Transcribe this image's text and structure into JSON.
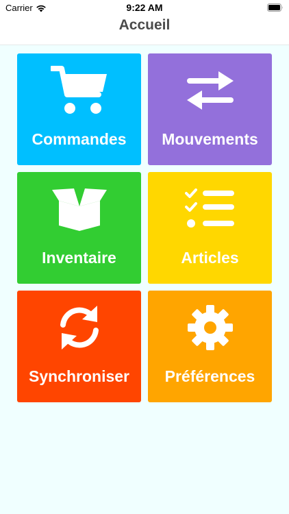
{
  "status_bar": {
    "carrier": "Carrier",
    "time": "9:22 AM"
  },
  "nav": {
    "title": "Accueil"
  },
  "tiles": [
    {
      "label": "Commandes",
      "icon": "shopping-cart-icon",
      "color": "#00BFFF"
    },
    {
      "label": "Mouvements",
      "icon": "exchange-arrows-icon",
      "color": "#9370DB"
    },
    {
      "label": "Inventaire",
      "icon": "open-box-icon",
      "color": "#32CD32"
    },
    {
      "label": "Articles",
      "icon": "checklist-icon",
      "color": "#FFD700"
    },
    {
      "label": "Synchroniser",
      "icon": "sync-icon",
      "color": "#FF4500"
    },
    {
      "label": "Préférences",
      "icon": "gear-icon",
      "color": "#FFA500"
    }
  ]
}
